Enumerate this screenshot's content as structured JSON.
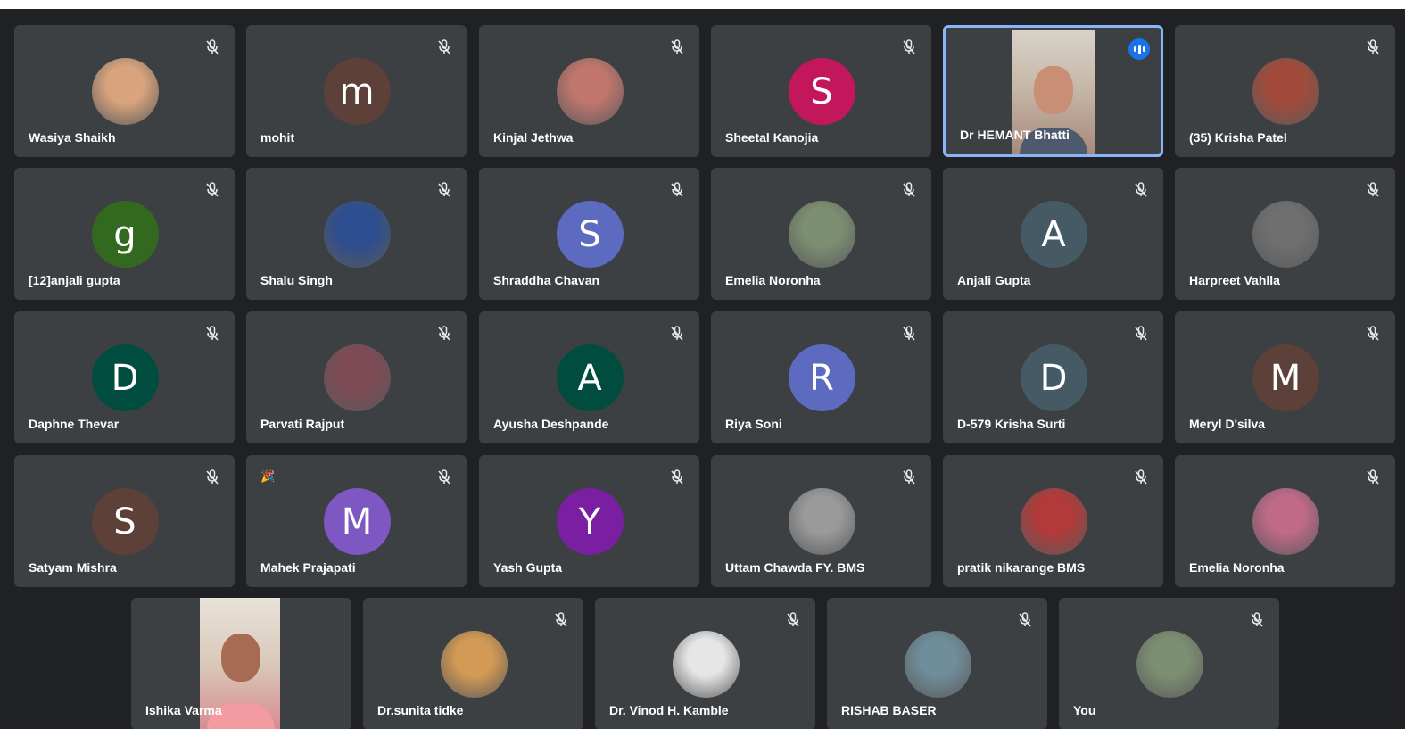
{
  "participants": [
    {
      "name": "Wasiya Shaikh",
      "avatar": "photo",
      "tone": "#d9a47d",
      "muted": true
    },
    {
      "name": "mohit",
      "avatar": "letter",
      "letter": "m",
      "color": "#5d4037",
      "muted": true
    },
    {
      "name": "Kinjal Jethwa",
      "avatar": "photo",
      "tone": "#c0766d",
      "muted": true
    },
    {
      "name": "Sheetal Kanojia",
      "avatar": "letter",
      "letter": "S",
      "color": "#c2185b",
      "muted": true
    },
    {
      "name": "Dr HEMANT Bhatti",
      "avatar": "video",
      "speaking": true,
      "muted": false
    },
    {
      "name": "(35) Krisha Patel",
      "avatar": "photo",
      "tone": "#a24b3b",
      "muted": true
    },
    {
      "name": "[12]anjali gupta",
      "avatar": "letter",
      "letter": "g",
      "color": "#33691e",
      "muted": true
    },
    {
      "name": "Shalu Singh",
      "avatar": "photo",
      "tone": "#2c4d8f",
      "muted": true
    },
    {
      "name": "Shraddha Chavan",
      "avatar": "letter",
      "letter": "S",
      "color": "#5c6bc0",
      "muted": true
    },
    {
      "name": "Emelia Noronha",
      "avatar": "photo",
      "tone": "#7d8f72",
      "muted": true
    },
    {
      "name": "Anjali Gupta",
      "avatar": "letter",
      "letter": "A",
      "color": "#455a64",
      "muted": true
    },
    {
      "name": "Harpreet Vahlla",
      "avatar": "photo",
      "tone": "#6f6f6f",
      "muted": true
    },
    {
      "name": "Daphne Thevar",
      "avatar": "letter",
      "letter": "D",
      "color": "#004d40",
      "muted": true
    },
    {
      "name": "Parvati Rajput",
      "avatar": "photo",
      "tone": "#7e4a55",
      "muted": true
    },
    {
      "name": "Ayusha Deshpande",
      "avatar": "letter",
      "letter": "A",
      "color": "#004d40",
      "muted": true
    },
    {
      "name": "Riya Soni",
      "avatar": "letter",
      "letter": "R",
      "color": "#5c6bc0",
      "muted": true
    },
    {
      "name": "D-579 Krisha Surti",
      "avatar": "letter",
      "letter": "D",
      "color": "#455a64",
      "muted": true
    },
    {
      "name": "Meryl D'silva",
      "avatar": "letter",
      "letter": "M",
      "color": "#5d4037",
      "muted": true
    },
    {
      "name": "Satyam Mishra",
      "avatar": "letter",
      "letter": "S",
      "color": "#5d4037",
      "muted": true
    },
    {
      "name": "Mahek Prajapati",
      "avatar": "letter",
      "letter": "M",
      "color": "#7e57c2",
      "muted": true,
      "reaction": "🎉"
    },
    {
      "name": "Yash Gupta",
      "avatar": "letter",
      "letter": "Y",
      "color": "#7b1fa2",
      "muted": true
    },
    {
      "name": "Uttam Chawda FY. BMS",
      "avatar": "photo",
      "tone": "#9a9a9a",
      "muted": true
    },
    {
      "name": "pratik nikarange BMS",
      "avatar": "photo",
      "tone": "#b23a3a",
      "muted": true
    },
    {
      "name": "Emelia Noronha",
      "avatar": "photo",
      "tone": "#c06a88",
      "muted": true
    },
    {
      "name": "Ishika Varma",
      "avatar": "video2",
      "muted": false
    },
    {
      "name": "Dr.sunita tidke",
      "avatar": "photo",
      "tone": "#d39a55",
      "muted": true
    },
    {
      "name": "Dr. Vinod H. Kamble",
      "avatar": "photo",
      "tone": "#e6e6e6",
      "muted": true
    },
    {
      "name": "RISHAB BASER",
      "avatar": "photo",
      "tone": "#6f8d9a",
      "muted": true
    },
    {
      "name": "You",
      "avatar": "photo",
      "tone": "#7d8f72",
      "muted": true
    }
  ]
}
